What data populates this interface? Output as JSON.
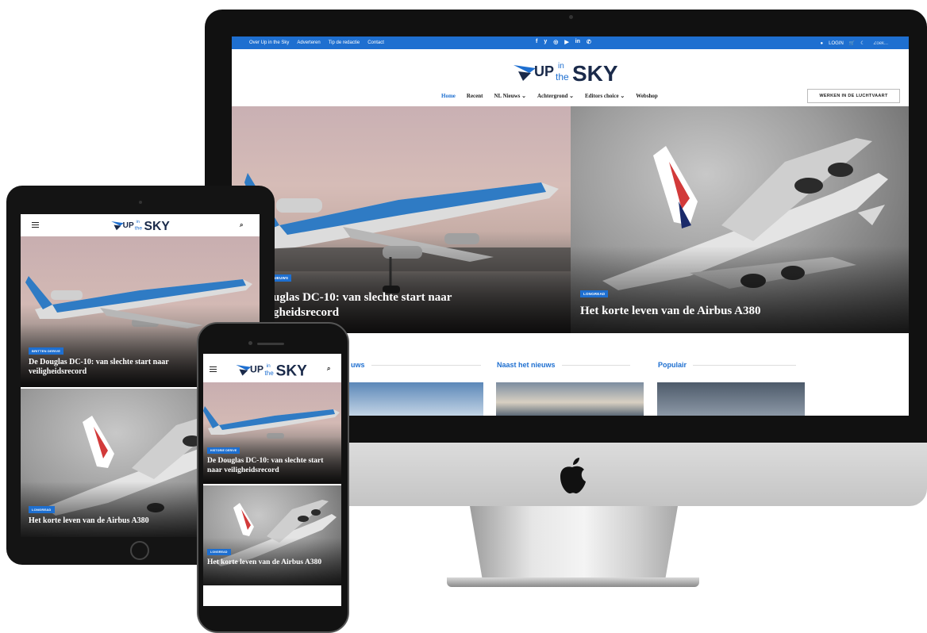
{
  "brand": {
    "logo_up": "UP",
    "logo_in": "in",
    "logo_the": "the",
    "logo_sky": "SKY",
    "accent": "#1e6fd0",
    "logo_dark": "#1a2a4a"
  },
  "desktop": {
    "topbar": {
      "links": [
        "Over Up in the Sky",
        "Adverteren",
        "Tip de redactie",
        "Contact"
      ],
      "social_icons": [
        "facebook-icon",
        "twitter-icon",
        "instagram-icon",
        "youtube-icon",
        "linkedin-icon",
        "whatsapp-icon"
      ],
      "social_glyphs": [
        "f",
        "y",
        "◎",
        "▶",
        "in",
        "✆"
      ],
      "login_label": "LOGIN",
      "search_placeholder": "Zoek..."
    },
    "nav": {
      "items": [
        "Home",
        "Recent",
        "NL Nieuws",
        "Achtergrond",
        "Editors choice",
        "Webshop"
      ],
      "dropdown_marker": "⌄",
      "cta_label": "WERKEN IN DE LUCHTVAART"
    },
    "hero_left": {
      "badge": "NIEUWS",
      "title_line1": "uglas DC-10: van slechte start naar",
      "title_line2": "gheidsrecord"
    },
    "hero_right": {
      "badge": "LONGREAD",
      "title": "Het korte leven van de Airbus A380"
    },
    "sections": [
      "uws",
      "Naast het nieuws",
      "Populair"
    ]
  },
  "tablet": {
    "hero1": {
      "badge": "BRITTEN DERIVE",
      "title": "De Douglas DC-10: van slechte start naar veiligheidsrecord"
    },
    "hero2": {
      "badge": "LONGREAD",
      "title": "Het korte leven van de Airbus A380"
    }
  },
  "phone": {
    "hero1": {
      "badge": "HISTORIE DERIVE",
      "title": "De Douglas DC-10: van slechte start naar veiligheidsrecord"
    },
    "hero2": {
      "badge": "LONGREAD",
      "title": "Het korte leven van de Airbus A380"
    }
  }
}
